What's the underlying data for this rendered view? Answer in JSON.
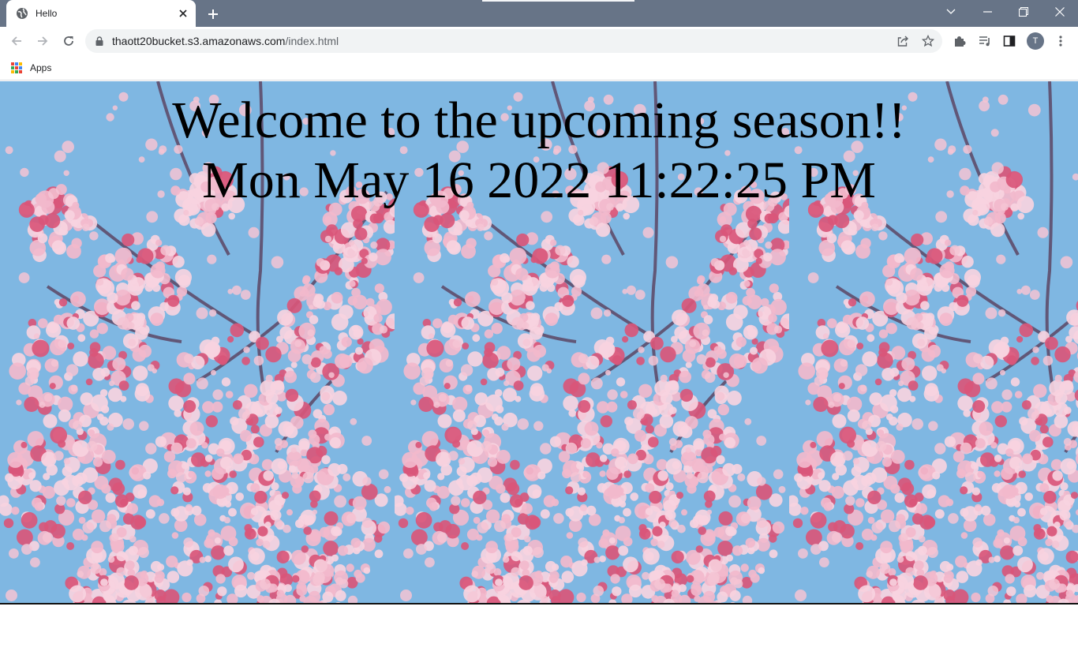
{
  "browser": {
    "tab": {
      "title": "Hello",
      "favicon": "globe-icon"
    },
    "address_bar": {
      "host": "thaott20bucket.s3.amazonaws.com",
      "path": "/index.html"
    },
    "profile_initial": "T",
    "bookmarks": [
      {
        "label": "Apps",
        "icon": "apps-grid-icon"
      }
    ],
    "icons": {
      "back": "back-arrow-icon",
      "forward": "forward-arrow-icon",
      "reload": "reload-icon",
      "lock": "lock-icon",
      "share": "share-icon",
      "bookmark": "star-icon",
      "extensions": "puzzle-icon",
      "media": "media-queue-icon",
      "side_panel": "side-panel-icon",
      "menu": "kebab-menu-icon"
    },
    "colors": {
      "frame": "#677487",
      "omnibox": "#f1f3f4"
    }
  },
  "page": {
    "heading": "Welcome to the upcoming season!!",
    "datetime": "Mon May 16 2022 11:22:25 PM",
    "background": {
      "image": "cherry blossom branches against blue sky",
      "repeat": "horizontal",
      "colors": {
        "sky": "#7fb7e2",
        "blossom": "#f2b9cc",
        "blossom_deep": "#d9567a"
      }
    }
  }
}
